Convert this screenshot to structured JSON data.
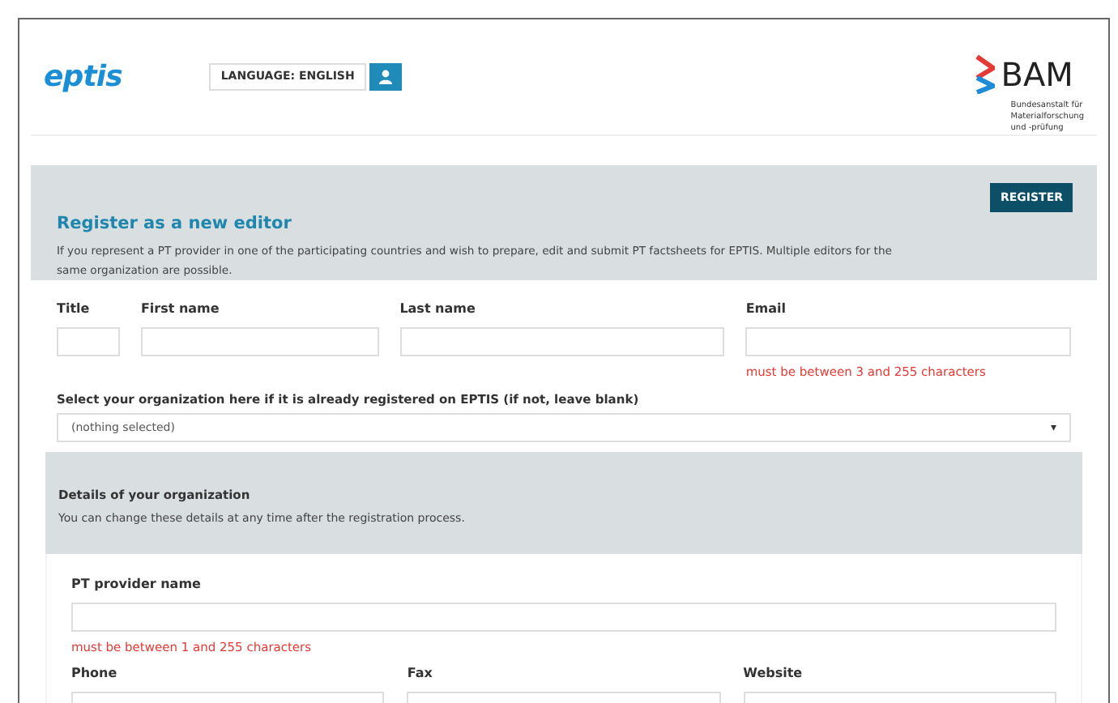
{
  "header": {
    "logo": "eptis",
    "language_button": "LANGUAGE: ENGLISH",
    "partner_logo": {
      "name": "BAM",
      "subtitle": [
        "Bundesanstalt für",
        "Materialforschung",
        "und -prüfung"
      ]
    }
  },
  "intro": {
    "title": "Register as a new editor",
    "text": "If you represent a PT provider in one of the participating countries and wish to prepare, edit and submit PT factsheets for EPTIS. Multiple editors for the same organization are possible.",
    "button": "REGISTER"
  },
  "person_fields": [
    {
      "label": "Title"
    },
    {
      "label": "First name"
    },
    {
      "label": "Last name"
    },
    {
      "label": "Email",
      "error": "must be between 3 and 255 characters"
    }
  ],
  "organization_select": {
    "label": "Select your organization here if it is already registered on EPTIS (if not, leave blank)",
    "value": "(nothing selected)",
    "caret": "▾"
  },
  "organization_details": {
    "title": "Details of your organization",
    "text": "You can change these details at any time after the registration process.",
    "provider_name": {
      "label": "PT provider name",
      "error": "must be between 1 and 255 characters"
    },
    "contact_fields": [
      {
        "label": "Phone"
      },
      {
        "label": "Fax"
      },
      {
        "label": "Website"
      }
    ]
  }
}
